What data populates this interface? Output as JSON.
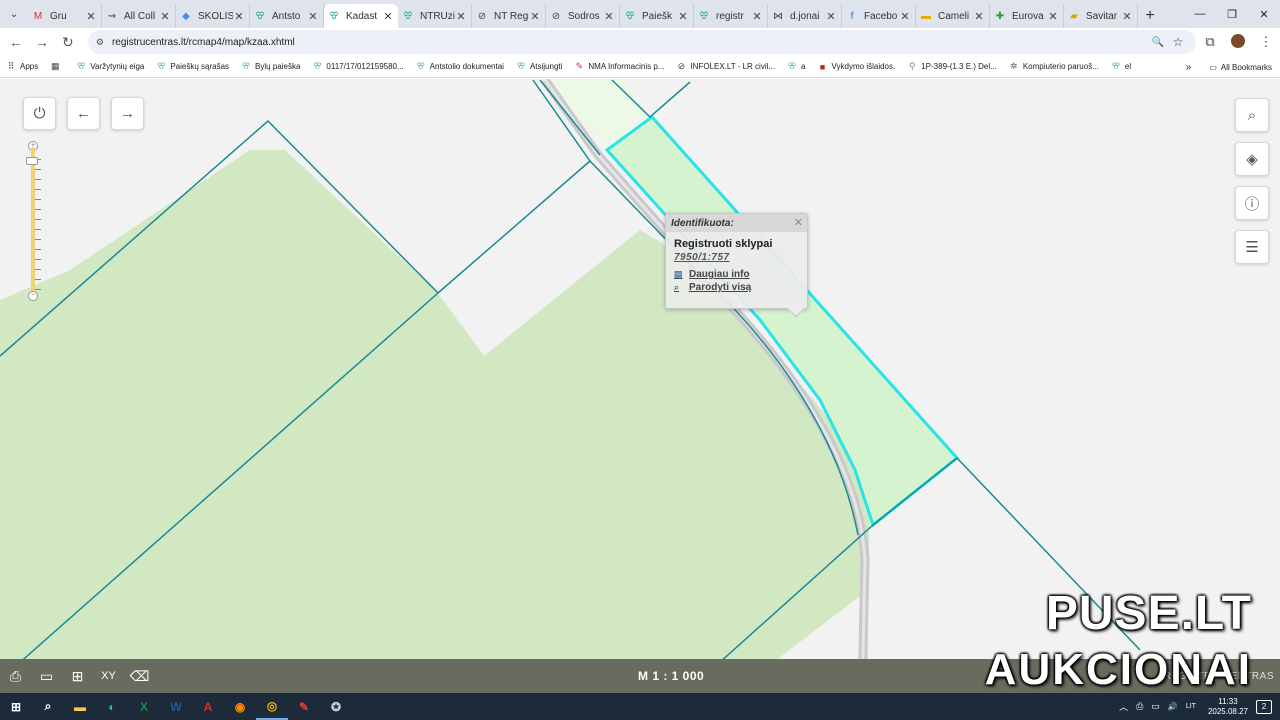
{
  "browser": {
    "tabs": [
      {
        "title": "Gru",
        "icon": "gmail-icon",
        "glyph": "M",
        "color": "#d93025"
      },
      {
        "title": "All Coll",
        "icon": "link-icon",
        "glyph": "⇝",
        "color": "#555"
      },
      {
        "title": "SKOLIS",
        "icon": "drive-icon",
        "glyph": "◆",
        "color": "#4a8af4"
      },
      {
        "title": "Antsto",
        "icon": "registry-icon",
        "glyph": "ꕢ",
        "color": "#2aa39a"
      },
      {
        "title": "Kadast",
        "icon": "registry-icon",
        "glyph": "ꕢ",
        "color": "#2aa39a"
      },
      {
        "title": "NTRUzi",
        "icon": "registry-icon",
        "glyph": "ꕢ",
        "color": "#2aa39a"
      },
      {
        "title": "NT Reg",
        "icon": "globe-icon",
        "glyph": "⊘",
        "color": "#444"
      },
      {
        "title": "Sodros",
        "icon": "globe-icon",
        "glyph": "⊘",
        "color": "#444"
      },
      {
        "title": "Paiešk",
        "icon": "registry-icon",
        "glyph": "ꕢ",
        "color": "#2aa39a"
      },
      {
        "title": "registr",
        "icon": "registry-icon",
        "glyph": "ꕢ",
        "color": "#2aa39a"
      },
      {
        "title": "d.jonai",
        "icon": "network-icon",
        "glyph": "⋈",
        "color": "#444"
      },
      {
        "title": "Facebo",
        "icon": "facebook-icon",
        "glyph": "f",
        "color": "#1877f2"
      },
      {
        "title": "Cameli",
        "icon": "camelia-icon",
        "glyph": "▬",
        "color": "#e5b000"
      },
      {
        "title": "Eurova",
        "icon": "pharmacy-icon",
        "glyph": "✚",
        "color": "#2c9a3c"
      },
      {
        "title": "Savitar",
        "icon": "savitarna-icon",
        "glyph": "▰",
        "color": "#d4a900"
      }
    ],
    "active_tab_index": 4,
    "close_glyph": "✕",
    "new_tab_glyph": "+",
    "window_controls": {
      "tabsearch": "⌄",
      "minimize": "—",
      "restore": "❐",
      "close": "✕"
    },
    "nav": {
      "back": "←",
      "forward": "→",
      "reload": "↻"
    },
    "url": "registrucentras.lt/rcmap4/map/kzaa.xhtml",
    "site_info_glyph": "⚙",
    "omnibox_icons": {
      "zoom": "🔍",
      "bookmark_star": "☆"
    },
    "toolbar_icons": {
      "extensions": "⧉",
      "menu": "⋮"
    },
    "bookmarks": [
      {
        "label": "Apps",
        "icon": "apps-grid-icon",
        "glyph": "⠿",
        "color": "#444"
      },
      {
        "label": "",
        "icon": "google-apps-icon",
        "glyph": "▦",
        "color": "#444"
      },
      {
        "label": "Varžytynių eiga",
        "icon": "registry-icon",
        "glyph": "ꕢ",
        "color": "#2aa39a"
      },
      {
        "label": "Paieškų sąrašas",
        "icon": "registry-icon",
        "glyph": "ꕢ",
        "color": "#2aa39a"
      },
      {
        "label": "Bylų paieška",
        "icon": "registry-icon",
        "glyph": "ꕢ",
        "color": "#2aa39a"
      },
      {
        "label": "0117/17/012159580...",
        "icon": "registry-icon",
        "glyph": "ꕢ",
        "color": "#2aa39a"
      },
      {
        "label": "Antstolio dokumentai",
        "icon": "registry-icon",
        "glyph": "ꕢ",
        "color": "#2aa39a"
      },
      {
        "label": "Atsijungti",
        "icon": "registry-icon",
        "glyph": "ꕢ",
        "color": "#2aa39a"
      },
      {
        "label": "NMA Informacinis p...",
        "icon": "nma-icon",
        "glyph": "✎",
        "color": "#c0392b"
      },
      {
        "label": "INFOLEX.LT - LR civil...",
        "icon": "globe-icon",
        "glyph": "⊘",
        "color": "#444"
      },
      {
        "label": "a",
        "icon": "registry-icon",
        "glyph": "ꕢ",
        "color": "#2aa39a"
      },
      {
        "label": "Vykdymo išlaidos.",
        "icon": "lx-icon",
        "glyph": "■",
        "color": "#b22"
      },
      {
        "label": "1P-389-(1.3 E.) Del...",
        "icon": "pin-icon",
        "glyph": "⚲",
        "color": "#888"
      },
      {
        "label": "Kompiuterio paruoš...",
        "icon": "settings-icon",
        "glyph": "✲",
        "color": "#666"
      },
      {
        "label": "el",
        "icon": "registry-icon",
        "glyph": "ꕢ",
        "color": "#2aa39a"
      }
    ],
    "bookmarks_overflow_glyph": "»",
    "all_bookmarks": {
      "label": "All Bookmarks",
      "glyph": "▭"
    }
  },
  "map": {
    "controls": {
      "power": "⏻",
      "back": "←",
      "forward": "→"
    },
    "right_buttons": [
      {
        "name": "search-icon",
        "glyph": "⌕"
      },
      {
        "name": "layers-icon",
        "glyph": "◈"
      },
      {
        "name": "info-icon",
        "glyph": "ⓘ"
      },
      {
        "name": "legend-icon",
        "glyph": "☰"
      }
    ],
    "zoom_plus": "+",
    "zoom_minus": "−",
    "colors": {
      "parcel_fill": "#d1e8c3",
      "parcel_line": "#1a8a95",
      "selected_line": "#27e4ea",
      "selected_fill": "#d6f3cf",
      "road": "#c9c9c9",
      "background": "#f2f2f2"
    },
    "popup": {
      "title": "Identifikuota:",
      "close": "✕",
      "layer": "Registruoti sklypai",
      "parcel_id": "7950/1:757",
      "links": [
        {
          "label": "Daugiau info",
          "glyph": "▤"
        },
        {
          "label": "Parodyti visą",
          "glyph": "⌕"
        }
      ]
    },
    "bottom_bar": {
      "tools": [
        {
          "name": "print-icon",
          "glyph": "⎙"
        },
        {
          "name": "ruler-icon",
          "glyph": "▭"
        },
        {
          "name": "add-page-icon",
          "glyph": "⊞"
        },
        {
          "name": "xy-icon",
          "glyph": "XY"
        },
        {
          "name": "eraser-icon",
          "glyph": "⌫"
        }
      ],
      "scale": "M 1 : 1 000",
      "brand": "REGISTRŲ CENTRAS"
    }
  },
  "watermark": {
    "line1": "PUSE.LT",
    "line2": "AUKCIONAI"
  },
  "taskbar": {
    "items": [
      {
        "name": "start-icon",
        "glyph": "⊞",
        "color": "#fff"
      },
      {
        "name": "search-icon",
        "glyph": "⌕",
        "color": "#fff"
      },
      {
        "name": "file-explorer-icon",
        "glyph": "▬",
        "color": "#f2c94c"
      },
      {
        "name": "edge-icon",
        "glyph": "◐",
        "color": "#2fb5c8"
      },
      {
        "name": "excel-icon",
        "glyph": "X",
        "color": "#1f8a4c"
      },
      {
        "name": "word-icon",
        "glyph": "W",
        "color": "#2b5797"
      },
      {
        "name": "acrobat-icon",
        "glyph": "A",
        "color": "#d93025"
      },
      {
        "name": "firefox-icon",
        "glyph": "◉",
        "color": "#ff8a00"
      },
      {
        "name": "chrome-icon",
        "glyph": "◎",
        "color": "#f4b400"
      },
      {
        "name": "app-icon",
        "glyph": "✎",
        "color": "#e53935"
      },
      {
        "name": "app2-icon",
        "glyph": "✪",
        "color": "#ccc"
      }
    ],
    "active_index": 8,
    "tray": {
      "chevron": "︿",
      "printer": "⎙",
      "network": "▭",
      "volume": "🔊",
      "lang": "LIT"
    },
    "time": "11:33",
    "date": "2025.08.27",
    "notifications": "2"
  }
}
